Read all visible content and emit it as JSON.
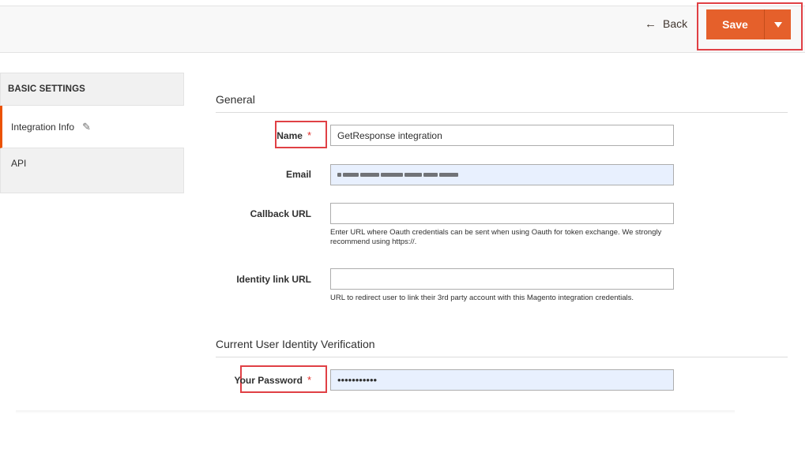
{
  "header": {
    "back_label": "Back",
    "save_label": "Save",
    "colors": {
      "save_bg": "#e5602b",
      "highlight": "#e04045"
    }
  },
  "sidebar": {
    "title": "BASIC SETTINGS",
    "items": [
      {
        "label": "Integration Info",
        "active": true,
        "icon": "pencil-icon"
      },
      {
        "label": "API",
        "active": false
      }
    ],
    "accent": "#eb5202"
  },
  "general": {
    "title": "General",
    "name": {
      "label": "Name",
      "value": "GetResponse integration",
      "required": true
    },
    "email": {
      "label": "Email",
      "value": ""
    },
    "callback": {
      "label": "Callback URL",
      "value": "",
      "note": "Enter URL where Oauth credentials can be sent when using Oauth for token exchange. We strongly recommend using https://."
    },
    "identity": {
      "label": "Identity link URL",
      "value": "",
      "note": "URL to redirect user to link their 3rd party account with this Magento integration credentials."
    }
  },
  "verification": {
    "title": "Current User Identity Verification",
    "password": {
      "label": "Your Password",
      "value": "•••••••••••",
      "required": true
    }
  },
  "required_marker": "*"
}
